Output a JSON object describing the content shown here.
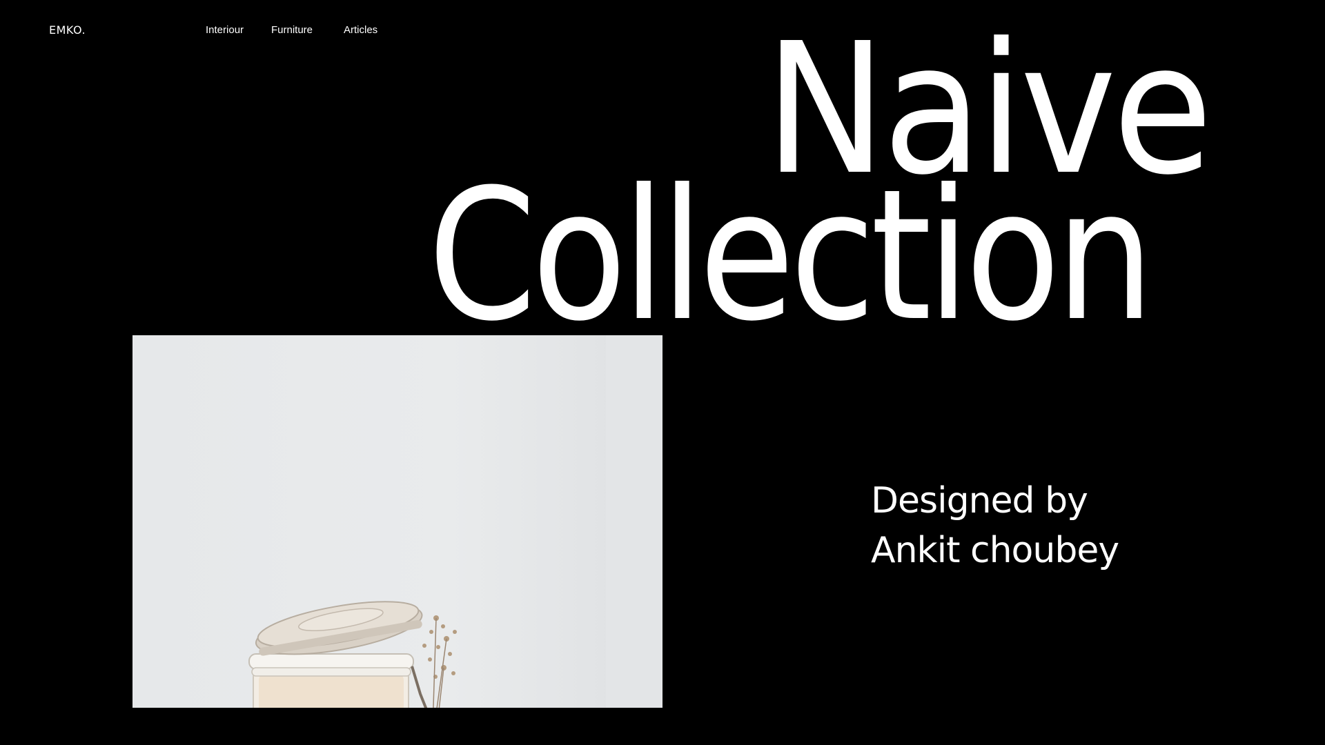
{
  "brand": {
    "logo_text": "EMKO."
  },
  "nav": {
    "items": [
      {
        "label": "Interiour"
      },
      {
        "label": "Furniture"
      },
      {
        "label": "Articles"
      }
    ]
  },
  "hero": {
    "line1": "Naive",
    "line2": "Collection"
  },
  "credit": {
    "line1": "Designed by",
    "line2": "Ankit choubey"
  },
  "colors": {
    "background": "#000000",
    "text": "#ffffff",
    "photo_bg": "#e8eaeb"
  },
  "image": {
    "subject": "glass jar with open lid and dried flowers"
  }
}
